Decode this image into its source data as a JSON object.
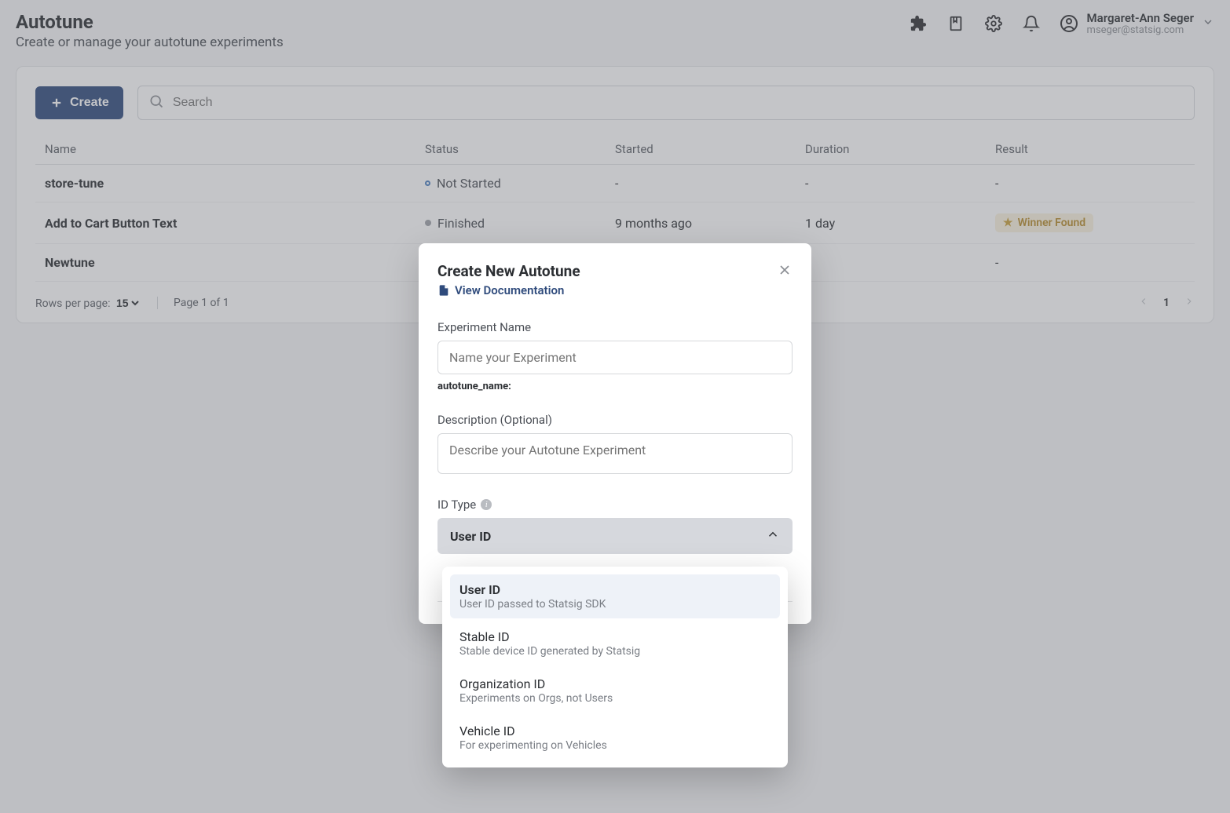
{
  "header": {
    "title": "Autotune",
    "subtitle": "Create or manage your autotune experiments",
    "user": {
      "name": "Margaret-Ann Seger",
      "email": "mseger@statsig.com"
    }
  },
  "toolbar": {
    "create_label": "Create",
    "search_placeholder": "Search"
  },
  "table": {
    "columns": {
      "name": "Name",
      "status": "Status",
      "started": "Started",
      "duration": "Duration",
      "result": "Result"
    },
    "rows": [
      {
        "name": "store-tune",
        "status": "Not Started",
        "status_style": "hollow",
        "started": "-",
        "duration": "-",
        "result": "-",
        "result_badge": ""
      },
      {
        "name": "Add to Cart Button Text",
        "status": "Finished",
        "status_style": "solid",
        "started": "9 months ago",
        "duration": "1 day",
        "result": "",
        "result_badge": "Winner Found"
      },
      {
        "name": "Newtune",
        "status": "",
        "status_style": "hollow",
        "started": "",
        "duration": "-",
        "result": "-",
        "result_badge": ""
      }
    ]
  },
  "pagination": {
    "rows_label": "Rows per page:",
    "rows_value": "15",
    "page_text": "Page 1 of 1",
    "current": "1"
  },
  "modal": {
    "title": "Create New Autotune",
    "doc_link": "View Documentation",
    "fields": {
      "name_label": "Experiment Name",
      "name_placeholder": "Name your Experiment",
      "slug_label": "autotune_name:",
      "desc_label": "Description (Optional)",
      "desc_placeholder": "Describe your Autotune Experiment",
      "idtype_label": "ID Type",
      "idtype_selected": "User ID"
    }
  },
  "dropdown": {
    "items": [
      {
        "title": "User ID",
        "desc": "User ID passed to Statsig SDK",
        "selected": true
      },
      {
        "title": "Stable ID",
        "desc": "Stable device ID generated by Statsig",
        "selected": false
      },
      {
        "title": "Organization ID",
        "desc": "Experiments on Orgs, not Users",
        "selected": false
      },
      {
        "title": "Vehicle ID",
        "desc": "For experimenting on Vehicles",
        "selected": false
      }
    ]
  }
}
